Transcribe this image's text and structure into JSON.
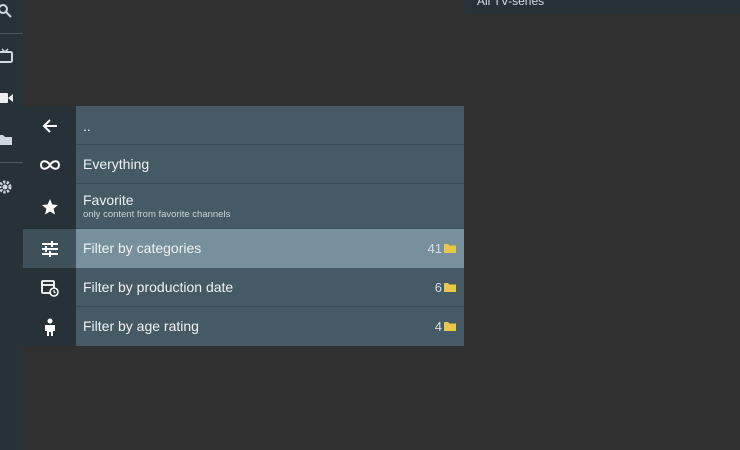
{
  "header": {
    "top_right_label": "All TV-series"
  },
  "menu": {
    "items": [
      {
        "id": "back",
        "icon": "arrow-back-icon",
        "title": "..",
        "subtitle": "",
        "count": ""
      },
      {
        "id": "everything",
        "icon": "infinity-icon",
        "title": "Everything",
        "subtitle": "",
        "count": ""
      },
      {
        "id": "favorite",
        "icon": "star-icon",
        "title": "Favorite",
        "subtitle": "only content from favorite channels",
        "count": ""
      },
      {
        "id": "categories",
        "icon": "sliders-icon",
        "title": "Filter by categories",
        "subtitle": "",
        "count": "41",
        "selected": true
      },
      {
        "id": "production-date",
        "icon": "calendar-clock-icon",
        "title": "Filter by production date",
        "subtitle": "",
        "count": "6"
      },
      {
        "id": "age-rating",
        "icon": "person-icon",
        "title": "Filter by age rating",
        "subtitle": "",
        "count": "4"
      }
    ]
  },
  "rail": {
    "icons": [
      "search-icon",
      "tv-icon",
      "video-camera-icon",
      "folder-icon",
      "gear-icon"
    ]
  },
  "colors": {
    "background": "#303030",
    "rail": "#263238",
    "menu_row": "#455a64",
    "selected_row": "#78909c",
    "folder": "#e8c84a"
  }
}
